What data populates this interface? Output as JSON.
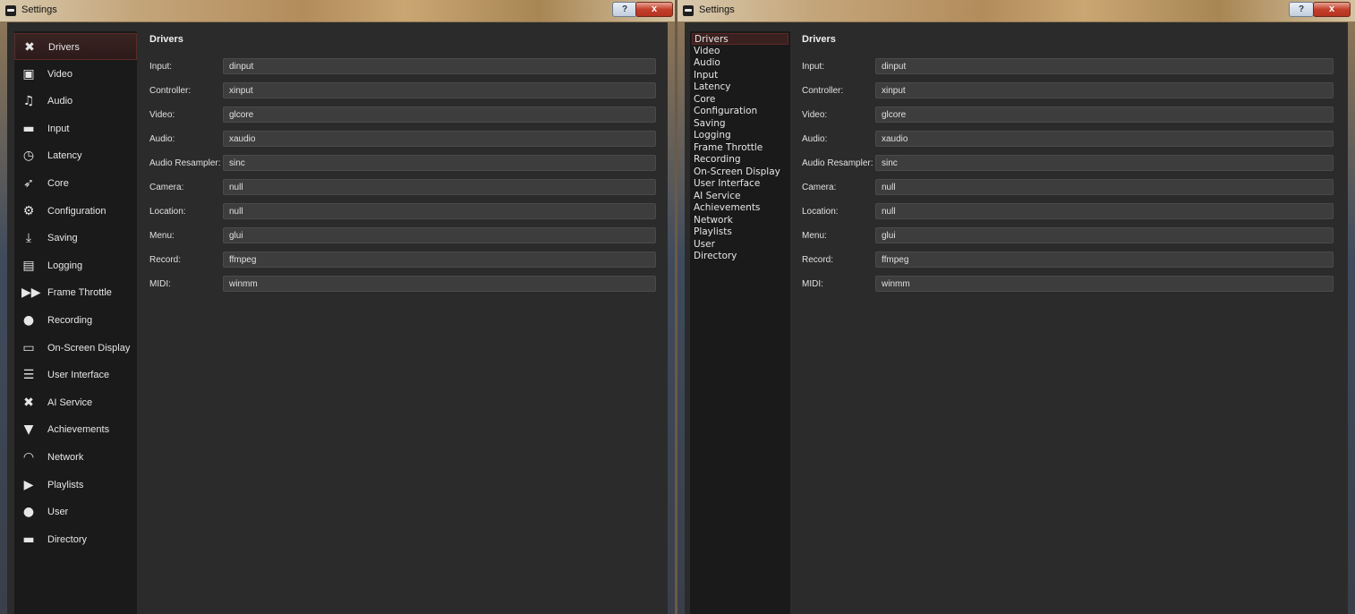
{
  "window": {
    "title": "Settings",
    "help_label": "?",
    "close_label": "x"
  },
  "sidebar_icon": {
    "items": [
      {
        "label": "Drivers",
        "icon": "tools-icon",
        "glyph": "✖"
      },
      {
        "label": "Video",
        "icon": "film-icon",
        "glyph": "▣"
      },
      {
        "label": "Audio",
        "icon": "music-note-icon",
        "glyph": "♫"
      },
      {
        "label": "Input",
        "icon": "gamepad-icon",
        "glyph": "▬"
      },
      {
        "label": "Latency",
        "icon": "stopwatch-icon",
        "glyph": "◷"
      },
      {
        "label": "Core",
        "icon": "rocket-icon",
        "glyph": "➶"
      },
      {
        "label": "Configuration",
        "icon": "gears-icon",
        "glyph": "⚙"
      },
      {
        "label": "Saving",
        "icon": "download-icon",
        "glyph": "⤓"
      },
      {
        "label": "Logging",
        "icon": "file-edit-icon",
        "glyph": "▤"
      },
      {
        "label": "Frame Throttle",
        "icon": "fast-forward-icon",
        "glyph": "▶▶"
      },
      {
        "label": "Recording",
        "icon": "video-camera-icon",
        "glyph": "●"
      },
      {
        "label": "On-Screen Display",
        "icon": "monitor-icon",
        "glyph": "▭"
      },
      {
        "label": "User Interface",
        "icon": "list-window-icon",
        "glyph": "☰"
      },
      {
        "label": "AI Service",
        "icon": "tools-icon",
        "glyph": "✖"
      },
      {
        "label": "Achievements",
        "icon": "trophy-icon",
        "glyph": "▼"
      },
      {
        "label": "Network",
        "icon": "wifi-icon",
        "glyph": "◠"
      },
      {
        "label": "Playlists",
        "icon": "playlist-file-icon",
        "glyph": "▶"
      },
      {
        "label": "User",
        "icon": "user-icon",
        "glyph": "●"
      },
      {
        "label": "Directory",
        "icon": "folder-open-icon",
        "glyph": "▬"
      }
    ]
  },
  "sidebar_compact": {
    "items": [
      "Drivers",
      "Video",
      "Audio",
      "Input",
      "Latency",
      "Core",
      "Configuration",
      "Saving",
      "Logging",
      "Frame Throttle",
      "Recording",
      "On-Screen Display",
      "User Interface",
      "AI Service",
      "Achievements",
      "Network",
      "Playlists",
      "User",
      "Directory"
    ]
  },
  "content": {
    "title": "Drivers",
    "rows": [
      {
        "label": "Input:",
        "value": "dinput"
      },
      {
        "label": "Controller:",
        "value": "xinput"
      },
      {
        "label": "Video:",
        "value": "glcore"
      },
      {
        "label": "Audio:",
        "value": "xaudio"
      },
      {
        "label": "Audio Resampler:",
        "value": "sinc"
      },
      {
        "label": "Camera:",
        "value": "null"
      },
      {
        "label": "Location:",
        "value": "null"
      },
      {
        "label": "Menu:",
        "value": "glui"
      },
      {
        "label": "Record:",
        "value": "ffmpeg"
      },
      {
        "label": "MIDI:",
        "value": "winmm"
      }
    ]
  }
}
